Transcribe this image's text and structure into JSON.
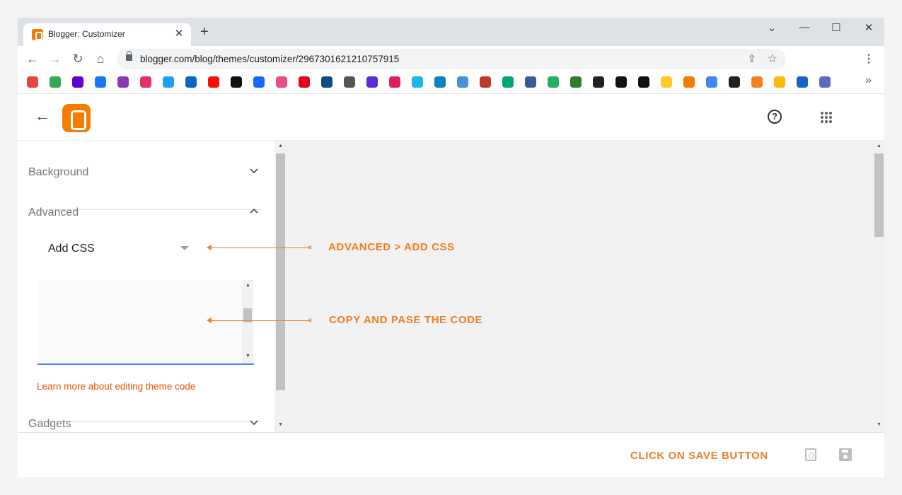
{
  "browser": {
    "tab_title": "Blogger: Customizer",
    "tab_close": "✕",
    "new_tab": "+",
    "url": "blogger.com/blog/themes/customizer/2967301621210757915",
    "window_controls": {
      "minimize": "⌄",
      "restore": "—",
      "maximize": "☐",
      "close": "✕"
    },
    "bookmarks_more": "»"
  },
  "bookmarks": [
    {
      "icon": "chrome-icon",
      "color": "#e8453c"
    },
    {
      "icon": "google-drive-icon",
      "color": "#34a853"
    },
    {
      "icon": "yahoo-icon",
      "color": "#6001d2"
    },
    {
      "icon": "facebook-icon",
      "color": "#1877f2"
    },
    {
      "icon": "messenger-icon",
      "color": "#8a3ab9"
    },
    {
      "icon": "instagram-icon",
      "color": "#e1306c"
    },
    {
      "icon": "twitter-icon",
      "color": "#1da1f2"
    },
    {
      "icon": "linkedin-icon",
      "color": "#0a66c2"
    },
    {
      "icon": "adobe-icon",
      "color": "#fa0f00"
    },
    {
      "icon": "adobe-creative-icon",
      "color": "#111111"
    },
    {
      "icon": "behance-icon",
      "color": "#1769ff"
    },
    {
      "icon": "dribbble-icon",
      "color": "#ea4c89"
    },
    {
      "icon": "pinterest-icon",
      "color": "#e60023"
    },
    {
      "icon": "bookmark-app-icon",
      "color": "#0f4c81"
    },
    {
      "icon": "feather-icon",
      "color": "#555555"
    },
    {
      "icon": "notion-icon",
      "color": "#5b2bd6"
    },
    {
      "icon": "slack-icon",
      "color": "#e01e5a"
    },
    {
      "icon": "vimeo-icon",
      "color": "#1ab7ea"
    },
    {
      "icon": "burst-icon",
      "color": "#0e7fc0"
    },
    {
      "icon": "layers-icon",
      "color": "#4a90d9"
    },
    {
      "icon": "blocks-icon",
      "color": "#c0392b"
    },
    {
      "icon": "dh-icon",
      "color": "#00a676"
    },
    {
      "icon": "send-icon",
      "color": "#3b5998"
    },
    {
      "icon": "recycle-icon",
      "color": "#27ae60"
    },
    {
      "icon": "gem-icon",
      "color": "#2e7d32"
    },
    {
      "icon": "wix-icon",
      "color": "#222222"
    },
    {
      "icon": "spotify-icon",
      "color": "#111111"
    },
    {
      "icon": "spotify-alt-icon",
      "color": "#111111"
    },
    {
      "icon": "firebase-icon",
      "color": "#ffca28"
    },
    {
      "icon": "blogger-icon",
      "color": "#f57c00"
    },
    {
      "icon": "google-icon",
      "color": "#4285f4"
    },
    {
      "icon": "codepen-icon",
      "color": "#222222"
    },
    {
      "icon": "stackoverflow-icon",
      "color": "#f48024"
    },
    {
      "icon": "colorful-app-icon",
      "color": "#fbbc05"
    },
    {
      "icon": "wifi-arc-icon",
      "color": "#1565c0"
    },
    {
      "icon": "stack-app-icon",
      "color": "#5c6bc0"
    }
  ],
  "sidebar": {
    "background_label": "Background",
    "advanced_label": "Advanced",
    "add_css_label": "Add CSS",
    "learn_more": "Learn more about editing theme code",
    "gadgets_label": "Gadgets"
  },
  "annotations": {
    "add_css": "ADVANCED > ADD CSS",
    "copy_code": "COPY AND PASE THE CODE",
    "save": "CLICK ON SAVE BUTTON"
  },
  "colors": {
    "accent": "#ef7d22",
    "blogger": "#f57c00",
    "link": "#e65100",
    "focus": "#4285f4"
  }
}
